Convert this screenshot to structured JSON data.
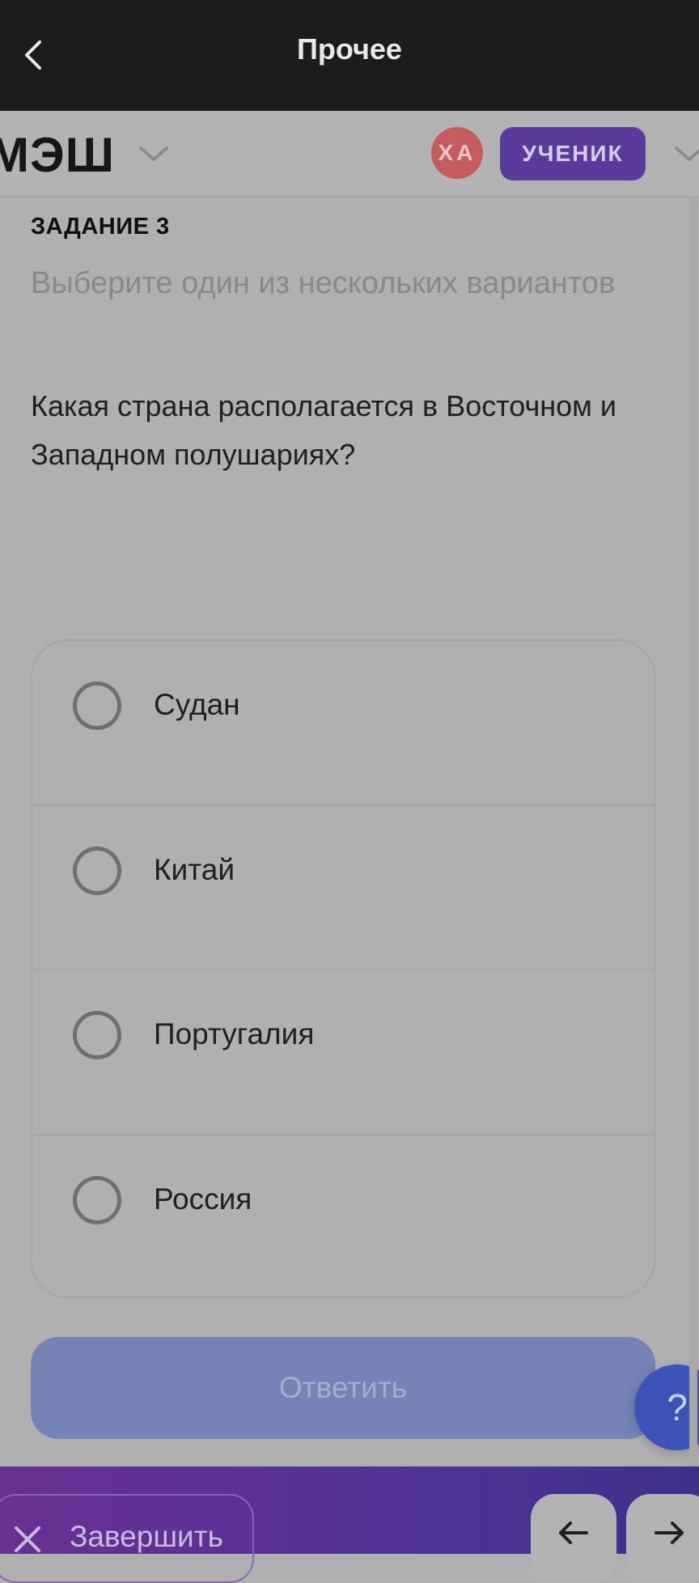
{
  "topbar": {
    "title": "Прочее"
  },
  "header": {
    "logo": "МЭШ",
    "avatar_initials": "ХА",
    "role": "УЧЕНИК"
  },
  "task": {
    "number_label": "ЗАДАНИЕ 3",
    "instruction": "Выберите один из нескольких вариантов",
    "question": "Какая страна располагается в Восточном и Западном полушариях?"
  },
  "options": [
    {
      "label": "Судан"
    },
    {
      "label": "Китай"
    },
    {
      "label": "Португалия"
    },
    {
      "label": "Россия"
    }
  ],
  "actions": {
    "submit": "Ответить",
    "help": "?",
    "finish": "Завершить"
  },
  "colors": {
    "accent": "#5a3b9a",
    "submit": "#7583b5",
    "help": "#3d53b8",
    "avatar": "#c35c5b"
  }
}
